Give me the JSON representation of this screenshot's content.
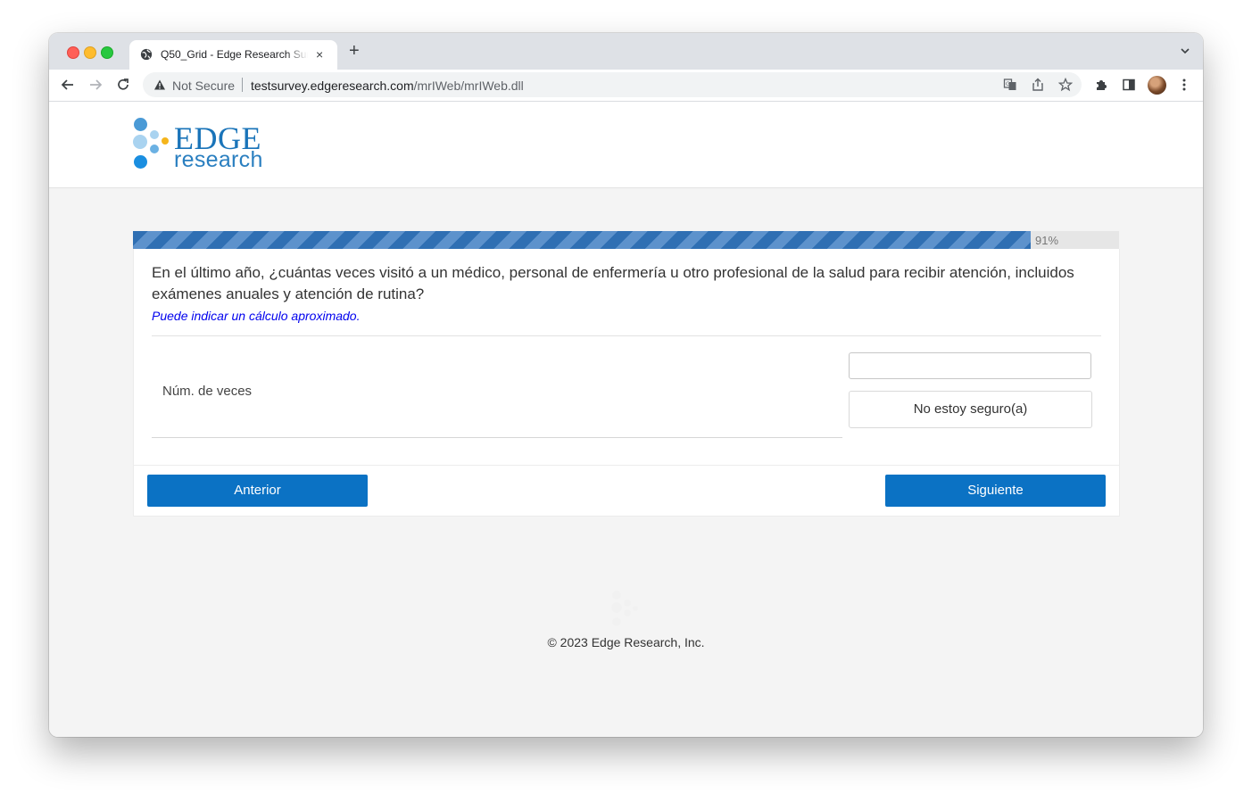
{
  "browser": {
    "tab_title": "Q50_Grid - Edge Research Survey",
    "tab_close": "×",
    "new_tab": "+",
    "security_label": "Not Secure",
    "url_host": "testsurvey.edgeresearch.com",
    "url_path": "/mrIWeb/mrIWeb.dll"
  },
  "logo": {
    "word": "EDGE",
    "sub": "research",
    "colors": {
      "primary": "#1a74b9",
      "light": "#a9d3f0",
      "accent": "#f5b51c"
    }
  },
  "progress": {
    "percent": 91,
    "label": "91%"
  },
  "question": {
    "text": "En el último año, ¿cuántas veces visitó a un médico, personal de enfermería u otro profesional de la salud para recibir atención, incluidos exámenes anuales y atención de rutina?",
    "hint": "Puede indicar un cálculo aproximado.",
    "row_label": "Núm. de veces",
    "input_value": "",
    "unsure_label": "No estoy seguro(a)"
  },
  "navigation": {
    "prev_label": "Anterior",
    "next_label": "Siguiente",
    "button_color": "#0b72c4"
  },
  "footer": {
    "copyright": "© 2023 Edge Research, Inc."
  }
}
